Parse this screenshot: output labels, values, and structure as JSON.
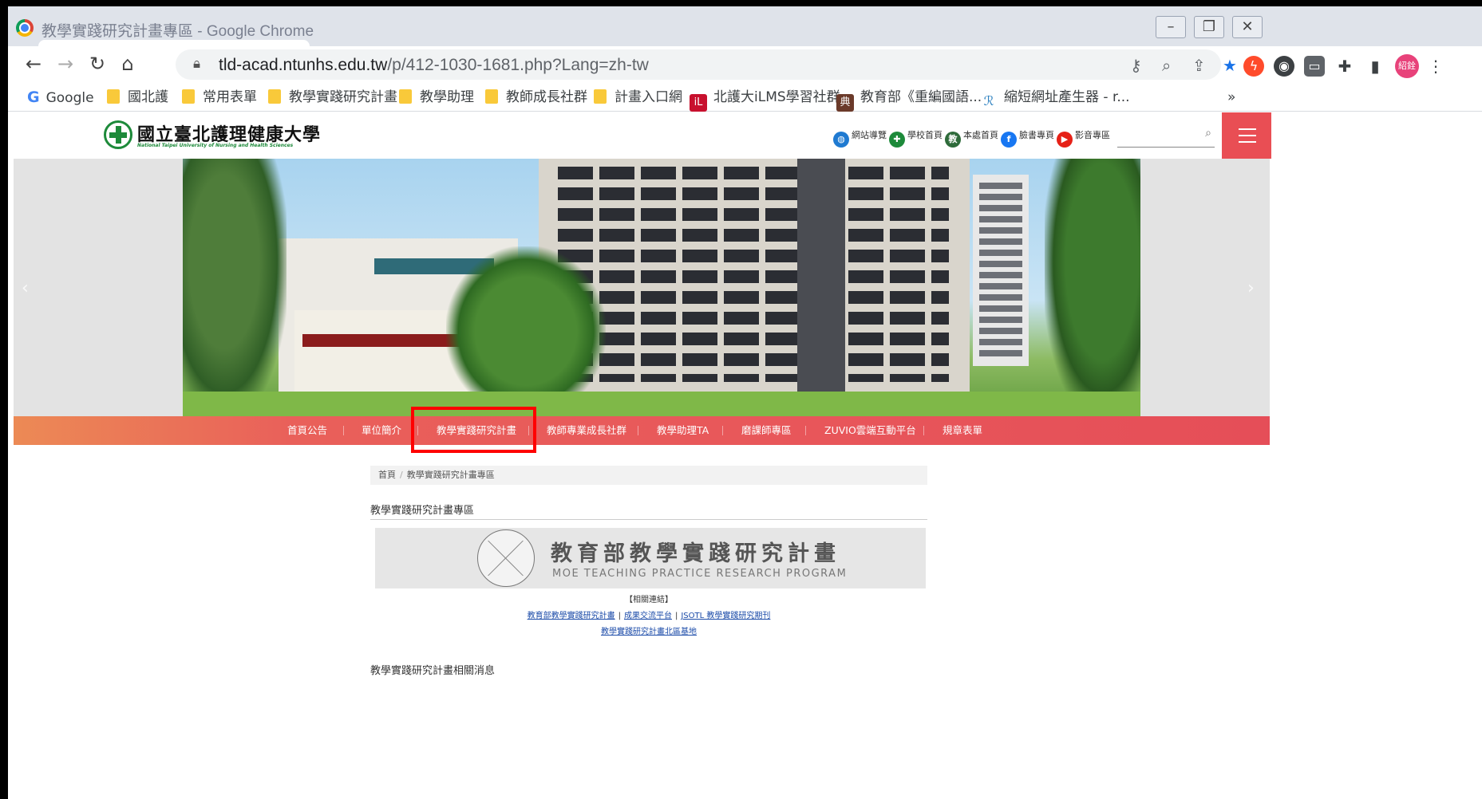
{
  "window": {
    "title": "教學實踐研究計畫專區 - Google Chrome",
    "minimize_glyph": "–",
    "restore_glyph": "❐",
    "close_glyph": "✕"
  },
  "toolbar": {
    "url_host": "tld-acad.ntunhs.edu.tw",
    "url_path": "/p/412-1030-1681.php?Lang=zh-tw",
    "profile_label": "紹銓"
  },
  "bookmarks": {
    "items": [
      {
        "label": "Google",
        "icon": "google-icon"
      },
      {
        "label": "國北護",
        "icon": "folder-icon"
      },
      {
        "label": "常用表單",
        "icon": "folder-icon"
      },
      {
        "label": "教學實踐研究計畫",
        "icon": "folder-icon"
      },
      {
        "label": "教學助理",
        "icon": "folder-icon"
      },
      {
        "label": "教師成長社群",
        "icon": "folder-icon"
      },
      {
        "label": "計畫入口網",
        "icon": "folder-icon"
      },
      {
        "label": "北護大iLMS學習社群",
        "icon": "ilms-icon"
      },
      {
        "label": "教育部《重編國語...",
        "icon": "moe-dict-icon"
      },
      {
        "label": "縮短網址產生器 - r...",
        "icon": "reurl-icon"
      }
    ],
    "overflow": "»"
  },
  "site": {
    "logo_name": "國立臺北護理健康大學",
    "logo_sub": "National Taipei University of Nursing and Health Sciences",
    "header_links": [
      {
        "label": "網站導覽",
        "icon": "globe-icon",
        "color": "#1f7ad1"
      },
      {
        "label": "學校首頁",
        "icon": "school-cross-icon",
        "color": "#1d8a3a"
      },
      {
        "label": "本處首頁",
        "icon": "teach-icon",
        "color": "#2e6b3a"
      },
      {
        "label": "臉書專頁",
        "icon": "facebook-icon",
        "color": "#1877f2"
      },
      {
        "label": "影音專區",
        "icon": "youtube-icon",
        "color": "#e62117"
      }
    ],
    "search_placeholder": ""
  },
  "nav": {
    "items": [
      "首頁公告",
      "單位簡介",
      "教學實踐研究計畫",
      "教師專業成長社群",
      "教學助理TA",
      "磨課師專區",
      "ZUVIO雲端互動平台",
      "規章表單"
    ],
    "highlighted": "教學實踐研究計畫",
    "highlight_color": "#ff0000"
  },
  "content": {
    "breadcrumb": [
      "首頁",
      "教學實踐研究計畫專區"
    ],
    "breadcrumb_sep": "/",
    "section_title": "教學實踐研究計畫專區",
    "moe_title_zh": "教育部教學實踐研究計畫",
    "moe_title_en": "MOE TEACHING PRACTICE RESEARCH PROGRAM",
    "related_label": "【相關連結】",
    "links_row1": [
      "教育部教學實踐研究計畫",
      "成果交流平台",
      "JSOTL 教學實踐研究期刊"
    ],
    "link_sep": "|",
    "links_row2": [
      "教學實踐研究計畫北區基地"
    ],
    "news_title": "教學實踐研究計畫相關消息"
  }
}
